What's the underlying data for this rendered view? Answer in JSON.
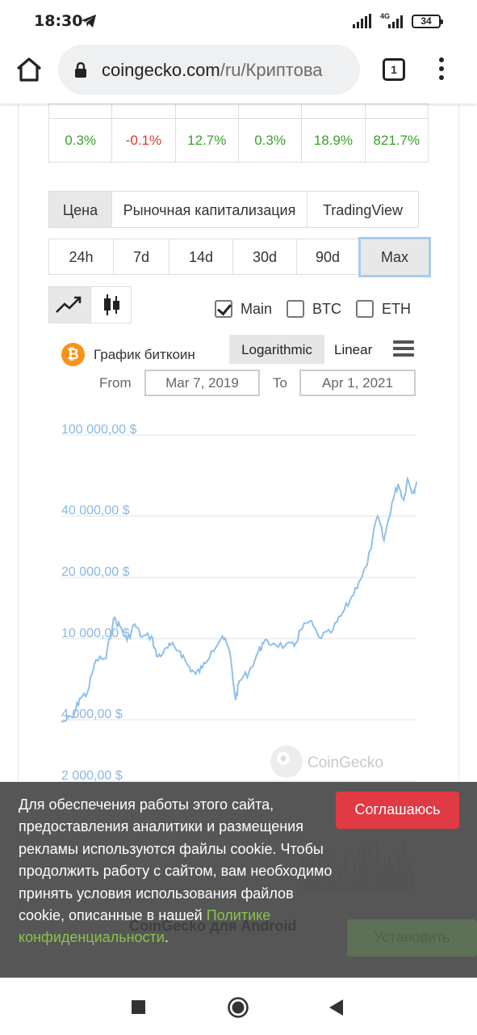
{
  "status_bar": {
    "time": "18:30",
    "network": "4G",
    "battery": "34"
  },
  "browser": {
    "url_domain": "coingecko.com",
    "url_path": "/ru/Криптова",
    "tab_count": "1"
  },
  "change_table": {
    "values": [
      "0.3%",
      "-0.1%",
      "12.7%",
      "0.3%",
      "18.9%",
      "821.7%"
    ]
  },
  "chart_tabs": {
    "price": "Цена",
    "market_cap": "Рыночная капитализация",
    "tradingview": "TradingView"
  },
  "ranges": [
    "24h",
    "7d",
    "14d",
    "30d",
    "90d",
    "Max"
  ],
  "series_toggles": {
    "main": "Main",
    "btc": "BTC",
    "eth": "ETH"
  },
  "chart_header": {
    "title": "График биткоин",
    "logarithmic": "Logarithmic",
    "linear": "Linear"
  },
  "date_range": {
    "from_label": "From",
    "from_value": "Mar 7, 2019",
    "to_label": "To",
    "to_value": "Apr 1, 2021"
  },
  "watermark": "CoinGecko",
  "chart_data": {
    "type": "line",
    "title": "График биткоин",
    "y_scale": "log",
    "y_ticks": [
      "100 000,00 $",
      "40 000,00 $",
      "20 000,00 $",
      "10 000,00 $",
      "4 000,00 $",
      "2 000,00 $"
    ],
    "y_tick_values": [
      100000,
      40000,
      20000,
      10000,
      4000,
      2000
    ],
    "x_range": [
      "2019-03-07",
      "2021-04-01"
    ],
    "series": [
      {
        "color": "#90c0ea",
        "points": [
          [
            "2019-03-07",
            3900
          ],
          [
            "2019-04-01",
            4100
          ],
          [
            "2019-04-15",
            5100
          ],
          [
            "2019-05-01",
            5400
          ],
          [
            "2019-05-20",
            7900
          ],
          [
            "2019-06-10",
            8000
          ],
          [
            "2019-06-26",
            12500
          ],
          [
            "2019-07-10",
            11500
          ],
          [
            "2019-07-25",
            9800
          ],
          [
            "2019-08-10",
            11800
          ],
          [
            "2019-08-25",
            10200
          ],
          [
            "2019-09-15",
            10300
          ],
          [
            "2019-09-26",
            8200
          ],
          [
            "2019-10-10",
            8500
          ],
          [
            "2019-10-26",
            9300
          ],
          [
            "2019-11-15",
            8700
          ],
          [
            "2019-12-01",
            7400
          ],
          [
            "2019-12-18",
            6700
          ],
          [
            "2020-01-01",
            7200
          ],
          [
            "2020-01-20",
            8700
          ],
          [
            "2020-02-13",
            10300
          ],
          [
            "2020-02-28",
            8700
          ],
          [
            "2020-03-12",
            5000
          ],
          [
            "2020-03-20",
            6200
          ],
          [
            "2020-04-10",
            6900
          ],
          [
            "2020-04-30",
            8700
          ],
          [
            "2020-05-10",
            9500
          ],
          [
            "2020-06-01",
            9500
          ],
          [
            "2020-06-25",
            9200
          ],
          [
            "2020-07-15",
            9200
          ],
          [
            "2020-07-28",
            11000
          ],
          [
            "2020-08-17",
            12200
          ],
          [
            "2020-09-05",
            10200
          ],
          [
            "2020-10-01",
            10700
          ],
          [
            "2020-10-22",
            12900
          ],
          [
            "2020-11-10",
            15300
          ],
          [
            "2020-11-30",
            19200
          ],
          [
            "2020-12-17",
            23000
          ],
          [
            "2021-01-08",
            40000
          ],
          [
            "2021-01-22",
            30500
          ],
          [
            "2021-02-08",
            46500
          ],
          [
            "2021-02-21",
            57500
          ],
          [
            "2021-03-05",
            48000
          ],
          [
            "2021-03-13",
            61000
          ],
          [
            "2021-03-25",
            52000
          ],
          [
            "2021-04-01",
            59000
          ]
        ]
      }
    ]
  },
  "cookie_banner": {
    "text": "Для обеспечения работы этого сайта, предоставления аналитики и размещения рекламы используются файлы cookie. Чтобы продолжить работу с сайтом, вам необходимо принять условия использования файлов cookie, описанные в нашей ",
    "link": "Политике конфиденциальности",
    "tail": ".",
    "accept": "Соглашаюсь"
  },
  "app_banner": {
    "title": "CoinGecko для Android",
    "install": "Установить"
  }
}
